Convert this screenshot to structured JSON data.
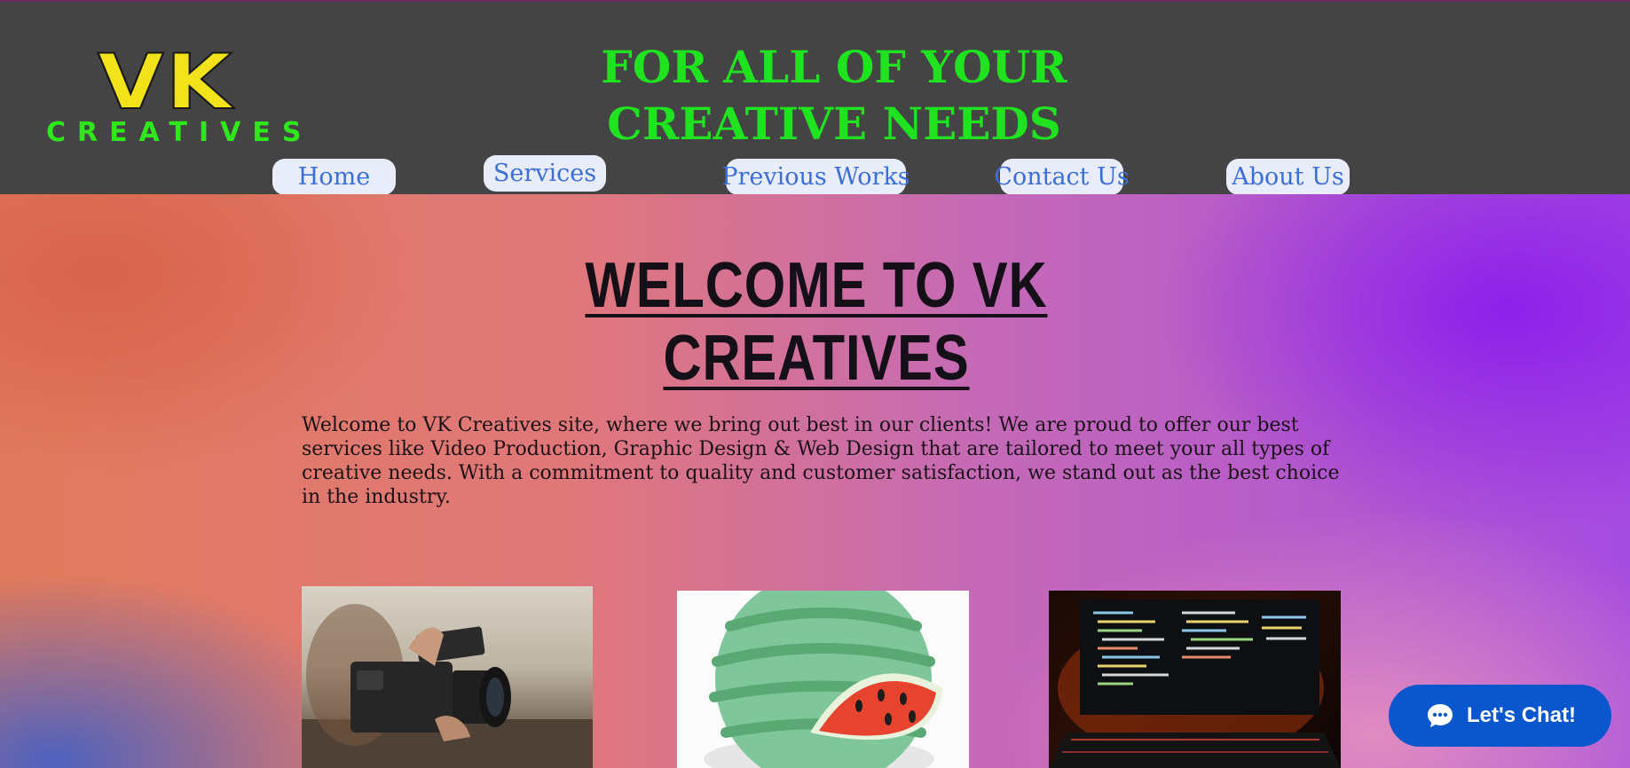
{
  "header": {
    "logo_main": "VK",
    "logo_sub": "CREATIVES",
    "tagline_line1": "FOR ALL OF YOUR",
    "tagline_line2": "CREATIVE NEEDS",
    "background_color": "#444444",
    "logo_color": "#f2e21a",
    "accent_green": "#1fe31f"
  },
  "nav": {
    "items": [
      {
        "label": "Home"
      },
      {
        "label": "Services"
      },
      {
        "label": "Previous Works"
      },
      {
        "label": "Contact Us"
      },
      {
        "label": "About Us"
      }
    ],
    "text_color": "#3a6fd6"
  },
  "main": {
    "heading": "WELCOME TO VK CREATIVES",
    "intro": "Welcome to VK Creatives site, where we bring out best in our clients! We are proud to offer our best services like Video Production, Graphic Design & Web Design that are tailored to meet your all types of creative needs. With a commitment to quality and customer satisfaction, we stand out as the best choice in the industry.",
    "cards": [
      {
        "subject": "video-camera"
      },
      {
        "subject": "watermelon-illustration"
      },
      {
        "subject": "code-on-monitor"
      }
    ]
  },
  "chat": {
    "label": "Let's Chat!",
    "icon": "chat-bubble-icon",
    "color": "#0a56cc"
  }
}
